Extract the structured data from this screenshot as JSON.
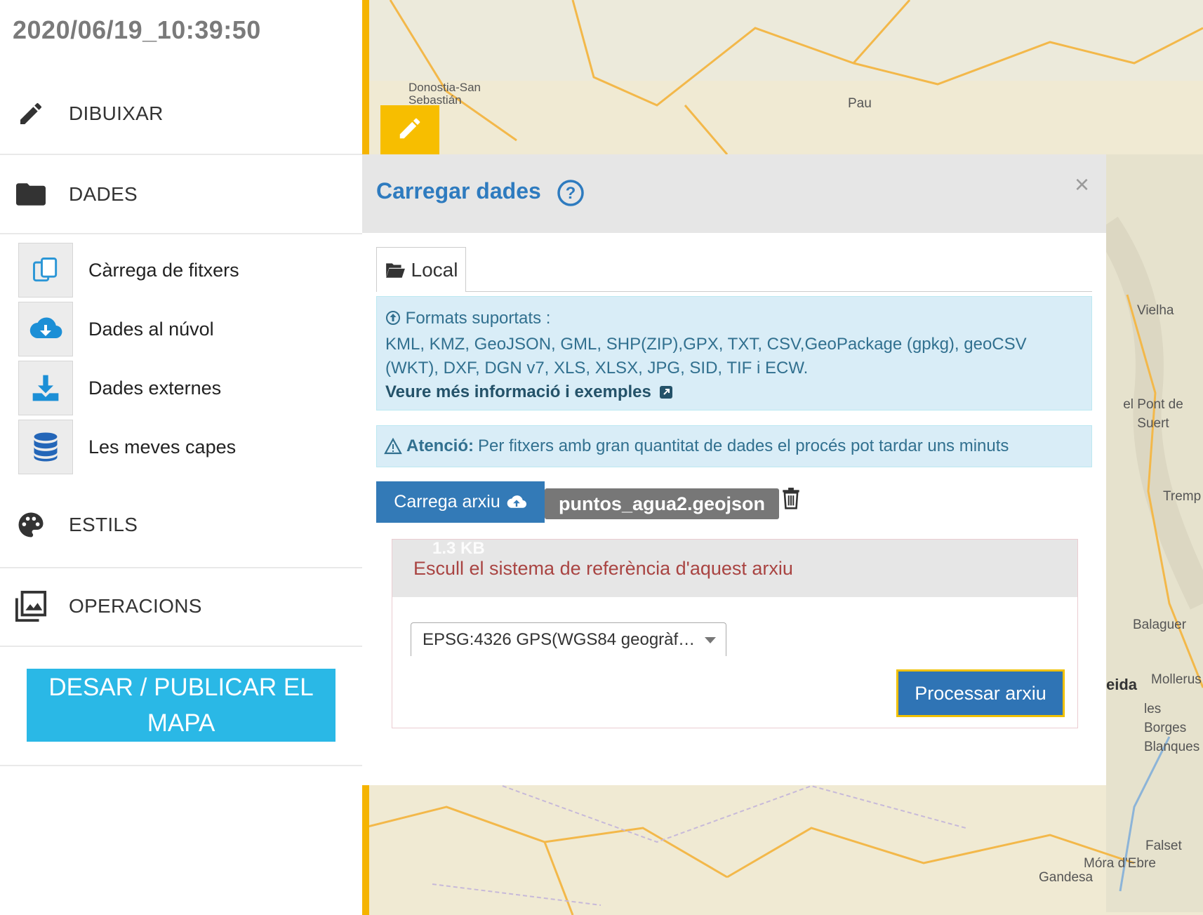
{
  "header": {
    "timestamp": "2020/06/19_10:39:50"
  },
  "sidebar": {
    "draw": {
      "label": "DIBUIXAR",
      "icon": "pencil-icon"
    },
    "data": {
      "label": "DADES",
      "icon": "folder-icon"
    },
    "sub_items": [
      {
        "label": "Càrrega de fitxers",
        "icon": "copy-files-icon"
      },
      {
        "label": "Dades al núvol",
        "icon": "cloud-download-icon"
      },
      {
        "label": "Dades externes",
        "icon": "download-icon"
      },
      {
        "label": "Les meves capes",
        "icon": "database-icon"
      }
    ],
    "styles": {
      "label": "ESTILS",
      "icon": "palette-icon"
    },
    "operations": {
      "label": "OPERACIONS",
      "icon": "images-icon"
    },
    "publish_label": "DESAR / PUBLICAR EL MAPA"
  },
  "map": {
    "labels": [
      "Donostia-San Sebastián",
      "Pau",
      "Vielha",
      "el Pont de Suert",
      "Tremp",
      "Balaguer",
      "eida",
      "Mollerus",
      "les Borges Blanques",
      "Falset",
      "Móra d'Ebre",
      "Gandesa"
    ]
  },
  "modal": {
    "title": "Carregar dades",
    "close": "×",
    "tab_local": "Local",
    "formats_title": "Formats suportats :",
    "formats_list": "KML, KMZ, GeoJSON, GML, SHP(ZIP),GPX, TXT, CSV,GeoPackage (gpkg), geoCSV (WKT), DXF, DGN v7, XLS, XLSX, JPG, SID, TIF i ECW.",
    "more_info": "Veure més informació i exemples",
    "warning_label": "Atenció:",
    "warning_text": "Per fitxers amb gran quantitat de dades el procés pot tardar uns minuts",
    "upload_label": "Carrega arxiu",
    "file_name": "puntos_agua2.geojson",
    "file_size": "1.3 KB",
    "crs_prompt": "Escull el sistema de referència d'aquest arxiu",
    "crs_selected": "EPSG:4326 GPS(WGS84 geogràf…",
    "process_label": "Processar arxiu"
  },
  "colors": {
    "accent": "#f5b400",
    "primary": "#337ab7",
    "publish": "#2ab8e6",
    "info_bg": "#d9edf7",
    "danger_text": "#a94442"
  }
}
